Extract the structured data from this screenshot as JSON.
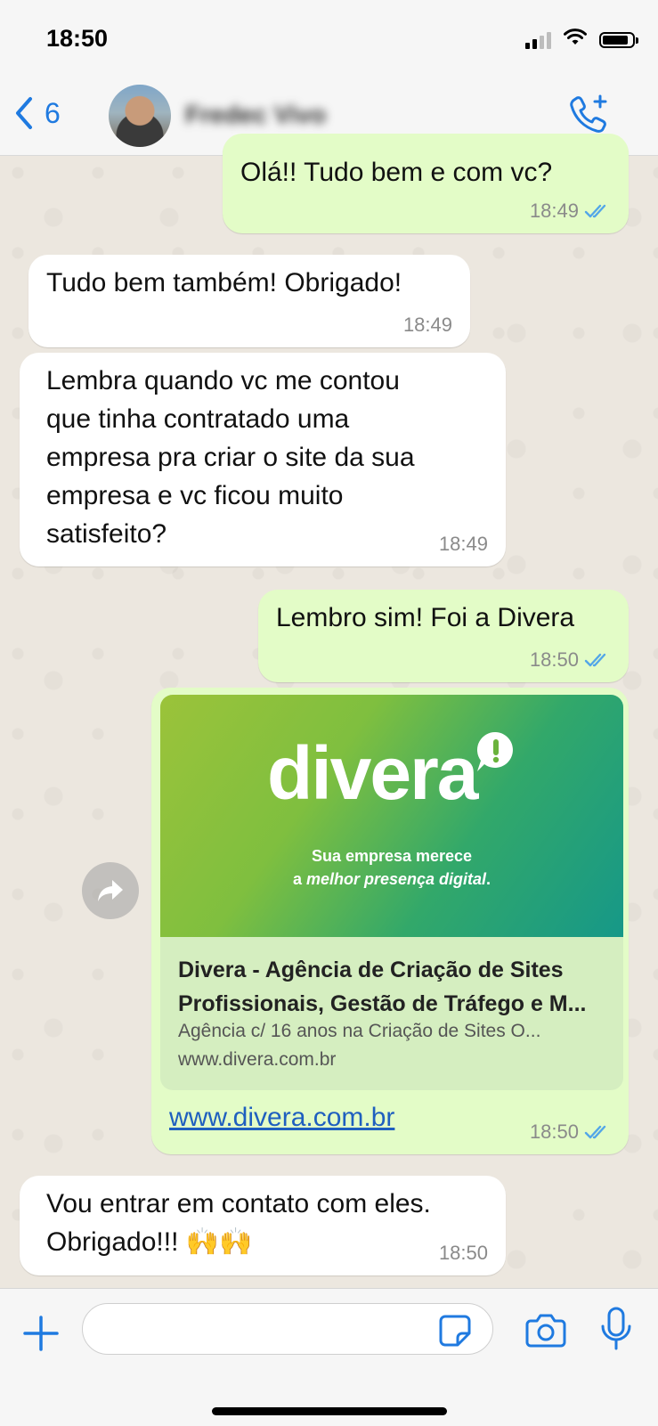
{
  "status_bar": {
    "time": "18:50"
  },
  "header": {
    "back_count": "6",
    "contact_name": "Fredec Vivo"
  },
  "messages": [
    {
      "direction": "out",
      "text": "Olá!! Tudo bem e com vc?",
      "time": "18:49",
      "read": true
    },
    {
      "direction": "in",
      "text": "Tudo bem também! Obrigado!",
      "time": "18:49"
    },
    {
      "direction": "in",
      "text": "Lembra quando vc me contou\nque tinha contratado uma\nempresa pra criar o site da sua\nempresa e vc ficou muito\nsatisfeito?",
      "time": "18:49"
    },
    {
      "direction": "out",
      "text": "Lembro sim! Foi a Divera",
      "time": "18:50",
      "read": true
    },
    {
      "direction": "out",
      "time": "18:50",
      "read": true,
      "link_preview": {
        "logo_text": "divera",
        "tagline_line1": "Sua empresa merece",
        "tagline_line2_prefix": "a ",
        "tagline_line2_emph": "melhor presença digital",
        "tagline_line2_suffix": ".",
        "title": "Divera - Agência de Criação de Sites Profissionais, Gestão de Tráfego e M...",
        "description": "Agência c/ 16 anos na Criação de Sites O...",
        "domain": "www.divera.com.br"
      },
      "url": "www.divera.com.br"
    },
    {
      "direction": "in",
      "text": "Vou entrar em contato com eles.\nObrigado!!! 🙌🙌",
      "time": "18:50"
    }
  ],
  "input": {
    "placeholder": ""
  },
  "colors": {
    "accent": "#1f7ae0",
    "outgoing_bubble": "#e3fcc7",
    "incoming_bubble": "#ffffff",
    "read_ticks": "#53a6e8",
    "link": "#1f5fbf"
  }
}
